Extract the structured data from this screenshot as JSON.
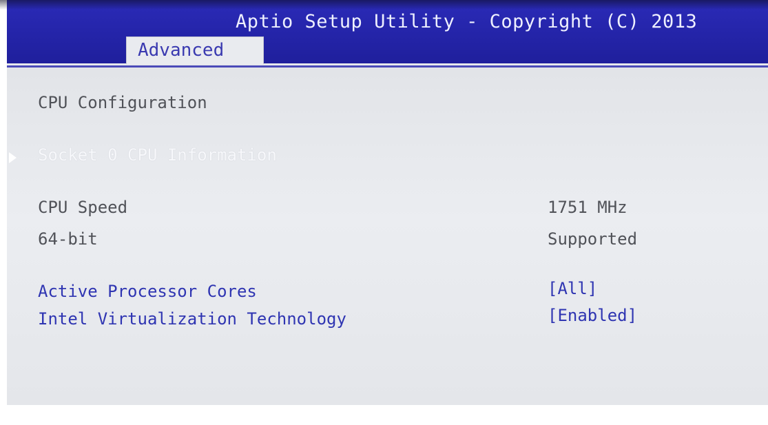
{
  "header": {
    "title": "Aptio Setup Utility - Copyright (C) 2013",
    "active_tab": "Advanced"
  },
  "section_title": "CPU Configuration",
  "submenu": {
    "label": "Socket 0 CPU Information",
    "icon": "submenu-arrow-icon"
  },
  "info": [
    {
      "label": "CPU Speed",
      "value": "1751 MHz"
    },
    {
      "label": "64-bit",
      "value": "Supported"
    }
  ],
  "settings": [
    {
      "label": "Active Processor Cores",
      "value": "[All]"
    },
    {
      "label": "Intel Virtualization Technology",
      "value": "[Enabled]"
    }
  ],
  "colors": {
    "header_bg": "#2424a8",
    "panel_bg": "#e6e8ec",
    "setting_text": "#2f35b2",
    "info_text": "#505258",
    "highlight_text": "#ffffff"
  }
}
